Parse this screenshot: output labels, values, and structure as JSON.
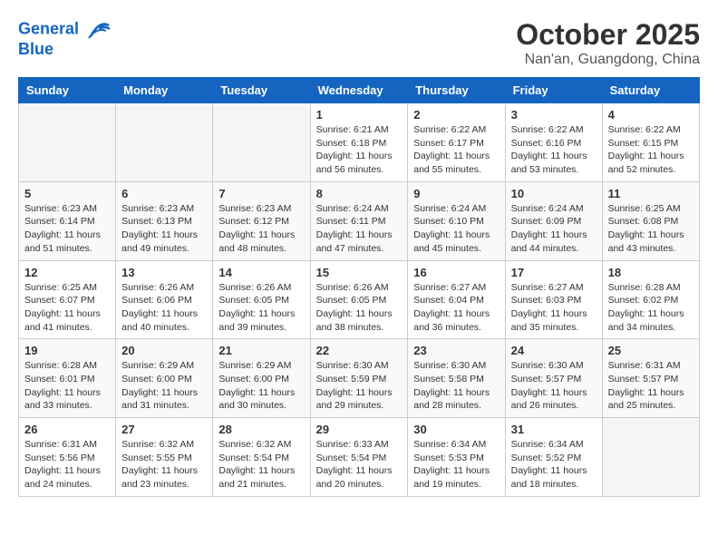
{
  "header": {
    "logo_line1": "General",
    "logo_line2": "Blue",
    "month": "October 2025",
    "location": "Nan'an, Guangdong, China"
  },
  "weekdays": [
    "Sunday",
    "Monday",
    "Tuesday",
    "Wednesday",
    "Thursday",
    "Friday",
    "Saturday"
  ],
  "weeks": [
    [
      {
        "day": "",
        "info": ""
      },
      {
        "day": "",
        "info": ""
      },
      {
        "day": "",
        "info": ""
      },
      {
        "day": "1",
        "info": "Sunrise: 6:21 AM\nSunset: 6:18 PM\nDaylight: 11 hours and 56 minutes."
      },
      {
        "day": "2",
        "info": "Sunrise: 6:22 AM\nSunset: 6:17 PM\nDaylight: 11 hours and 55 minutes."
      },
      {
        "day": "3",
        "info": "Sunrise: 6:22 AM\nSunset: 6:16 PM\nDaylight: 11 hours and 53 minutes."
      },
      {
        "day": "4",
        "info": "Sunrise: 6:22 AM\nSunset: 6:15 PM\nDaylight: 11 hours and 52 minutes."
      }
    ],
    [
      {
        "day": "5",
        "info": "Sunrise: 6:23 AM\nSunset: 6:14 PM\nDaylight: 11 hours and 51 minutes."
      },
      {
        "day": "6",
        "info": "Sunrise: 6:23 AM\nSunset: 6:13 PM\nDaylight: 11 hours and 49 minutes."
      },
      {
        "day": "7",
        "info": "Sunrise: 6:23 AM\nSunset: 6:12 PM\nDaylight: 11 hours and 48 minutes."
      },
      {
        "day": "8",
        "info": "Sunrise: 6:24 AM\nSunset: 6:11 PM\nDaylight: 11 hours and 47 minutes."
      },
      {
        "day": "9",
        "info": "Sunrise: 6:24 AM\nSunset: 6:10 PM\nDaylight: 11 hours and 45 minutes."
      },
      {
        "day": "10",
        "info": "Sunrise: 6:24 AM\nSunset: 6:09 PM\nDaylight: 11 hours and 44 minutes."
      },
      {
        "day": "11",
        "info": "Sunrise: 6:25 AM\nSunset: 6:08 PM\nDaylight: 11 hours and 43 minutes."
      }
    ],
    [
      {
        "day": "12",
        "info": "Sunrise: 6:25 AM\nSunset: 6:07 PM\nDaylight: 11 hours and 41 minutes."
      },
      {
        "day": "13",
        "info": "Sunrise: 6:26 AM\nSunset: 6:06 PM\nDaylight: 11 hours and 40 minutes."
      },
      {
        "day": "14",
        "info": "Sunrise: 6:26 AM\nSunset: 6:05 PM\nDaylight: 11 hours and 39 minutes."
      },
      {
        "day": "15",
        "info": "Sunrise: 6:26 AM\nSunset: 6:05 PM\nDaylight: 11 hours and 38 minutes."
      },
      {
        "day": "16",
        "info": "Sunrise: 6:27 AM\nSunset: 6:04 PM\nDaylight: 11 hours and 36 minutes."
      },
      {
        "day": "17",
        "info": "Sunrise: 6:27 AM\nSunset: 6:03 PM\nDaylight: 11 hours and 35 minutes."
      },
      {
        "day": "18",
        "info": "Sunrise: 6:28 AM\nSunset: 6:02 PM\nDaylight: 11 hours and 34 minutes."
      }
    ],
    [
      {
        "day": "19",
        "info": "Sunrise: 6:28 AM\nSunset: 6:01 PM\nDaylight: 11 hours and 33 minutes."
      },
      {
        "day": "20",
        "info": "Sunrise: 6:29 AM\nSunset: 6:00 PM\nDaylight: 11 hours and 31 minutes."
      },
      {
        "day": "21",
        "info": "Sunrise: 6:29 AM\nSunset: 6:00 PM\nDaylight: 11 hours and 30 minutes."
      },
      {
        "day": "22",
        "info": "Sunrise: 6:30 AM\nSunset: 5:59 PM\nDaylight: 11 hours and 29 minutes."
      },
      {
        "day": "23",
        "info": "Sunrise: 6:30 AM\nSunset: 5:58 PM\nDaylight: 11 hours and 28 minutes."
      },
      {
        "day": "24",
        "info": "Sunrise: 6:30 AM\nSunset: 5:57 PM\nDaylight: 11 hours and 26 minutes."
      },
      {
        "day": "25",
        "info": "Sunrise: 6:31 AM\nSunset: 5:57 PM\nDaylight: 11 hours and 25 minutes."
      }
    ],
    [
      {
        "day": "26",
        "info": "Sunrise: 6:31 AM\nSunset: 5:56 PM\nDaylight: 11 hours and 24 minutes."
      },
      {
        "day": "27",
        "info": "Sunrise: 6:32 AM\nSunset: 5:55 PM\nDaylight: 11 hours and 23 minutes."
      },
      {
        "day": "28",
        "info": "Sunrise: 6:32 AM\nSunset: 5:54 PM\nDaylight: 11 hours and 21 minutes."
      },
      {
        "day": "29",
        "info": "Sunrise: 6:33 AM\nSunset: 5:54 PM\nDaylight: 11 hours and 20 minutes."
      },
      {
        "day": "30",
        "info": "Sunrise: 6:34 AM\nSunset: 5:53 PM\nDaylight: 11 hours and 19 minutes."
      },
      {
        "day": "31",
        "info": "Sunrise: 6:34 AM\nSunset: 5:52 PM\nDaylight: 11 hours and 18 minutes."
      },
      {
        "day": "",
        "info": ""
      }
    ]
  ]
}
